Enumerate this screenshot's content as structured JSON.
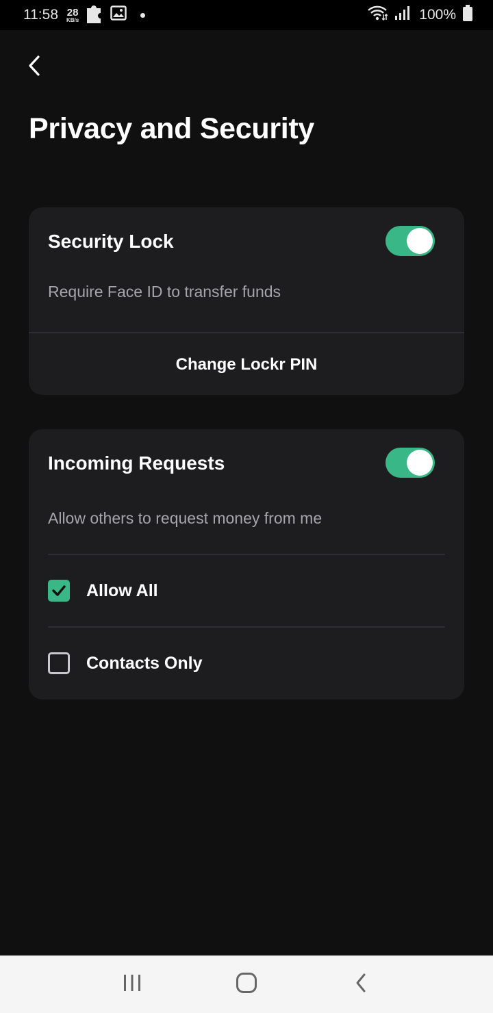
{
  "status_bar": {
    "time": "11:58",
    "speed_value": "28",
    "speed_unit": "KB/s",
    "battery": "100%",
    "icons": [
      "puzzle-icon",
      "image-icon",
      "notification-dot",
      "wifi-icon",
      "signal-icon",
      "battery-icon"
    ]
  },
  "header": {
    "title": "Privacy and Security",
    "back_icon": "chevron-left-icon"
  },
  "security_card": {
    "title": "Security Lock",
    "description": "Require Face ID to transfer funds",
    "toggle_on": true,
    "action_label": "Change Lockr PIN"
  },
  "requests_card": {
    "title": "Incoming Requests",
    "description": "Allow others to request money from me",
    "toggle_on": true,
    "options": [
      {
        "label": "Allow All",
        "checked": true
      },
      {
        "label": "Contacts Only",
        "checked": false
      }
    ]
  },
  "colors": {
    "accent": "#3ab786",
    "background": "#101010",
    "card": "#1d1d20",
    "muted_text": "#a6a6aa"
  },
  "nav_bar": {
    "icons": [
      "recent-apps-icon",
      "home-icon",
      "back-icon"
    ]
  }
}
